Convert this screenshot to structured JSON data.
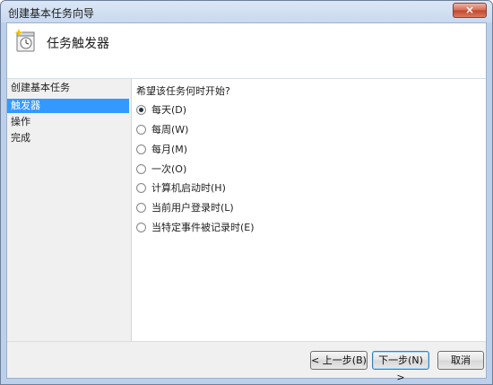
{
  "window": {
    "title": "创建基本任务向导",
    "close_icon": "×"
  },
  "header": {
    "title": "任务触发器",
    "icon": "clock-trigger-icon"
  },
  "nav": {
    "items": [
      {
        "label": "创建基本任务",
        "active": false
      },
      {
        "label": "触发器",
        "active": true
      },
      {
        "label": "操作",
        "active": false
      },
      {
        "label": "完成",
        "active": false
      }
    ]
  },
  "main": {
    "question": "希望该任务何时开始?",
    "options": [
      {
        "label": "每天(D)",
        "checked": true
      },
      {
        "label": "每周(W)",
        "checked": false
      },
      {
        "label": "每月(M)",
        "checked": false
      },
      {
        "label": "一次(O)",
        "checked": false
      },
      {
        "label": "计算机启动时(H)",
        "checked": false
      },
      {
        "label": "当前用户登录时(L)",
        "checked": false
      },
      {
        "label": "当特定事件被记录时(E)",
        "checked": false
      }
    ]
  },
  "buttons": {
    "back": "< 上一步(B)",
    "next": "下一步(N) >",
    "cancel": "取消"
  },
  "colors": {
    "nav_selected": "#3399ff",
    "close_button": "#c2452c"
  }
}
